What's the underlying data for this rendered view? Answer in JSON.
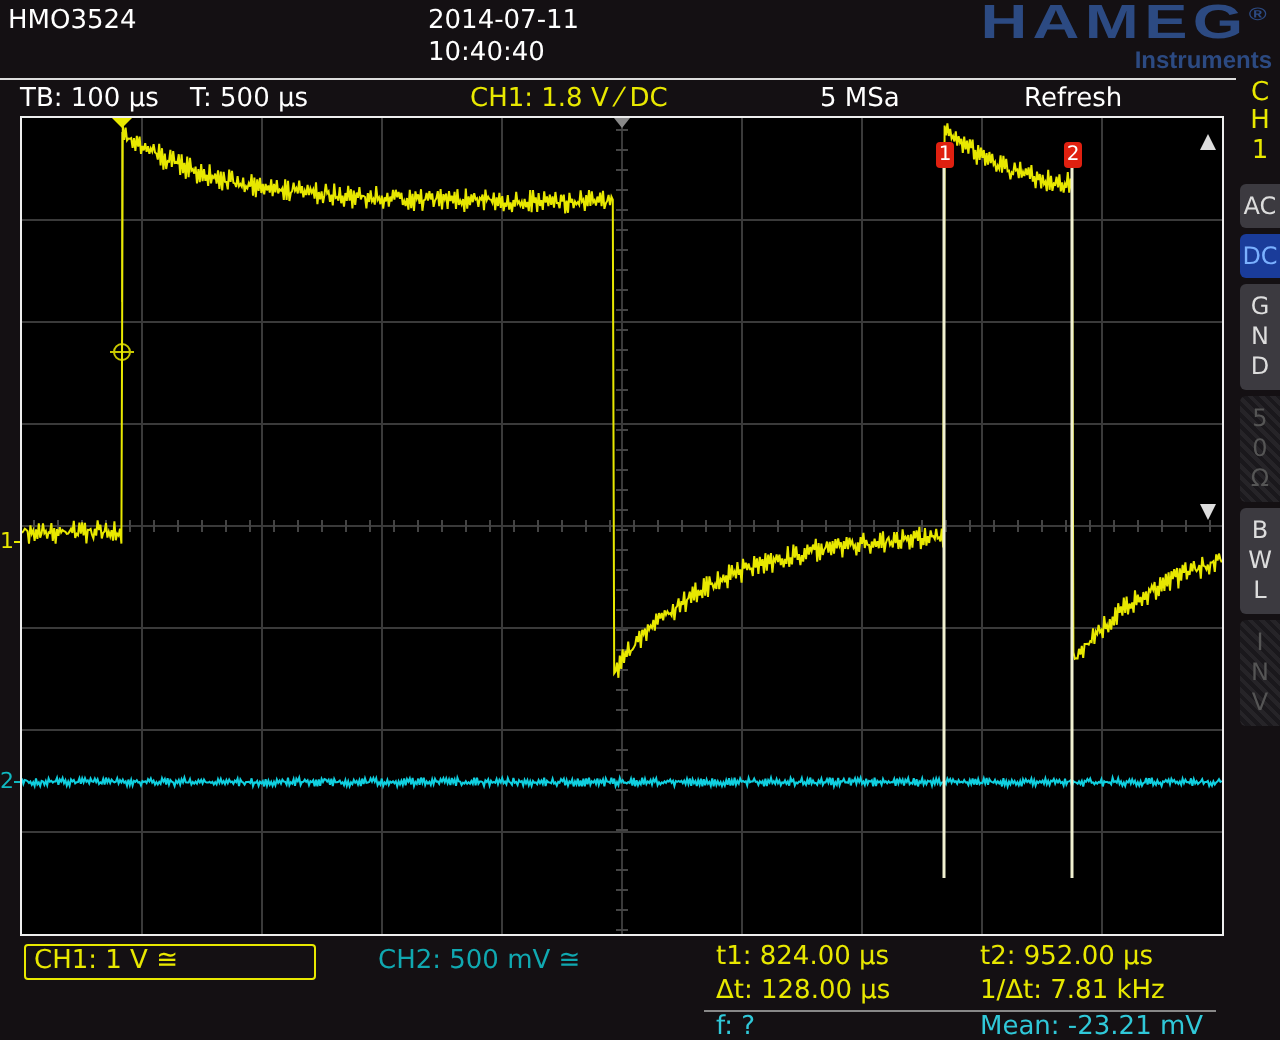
{
  "header": {
    "model": "HMO3524",
    "date": "2014-07-11",
    "time": "10:40:40",
    "brand": "HAMEG$^{®}$",
    "brand_sub": "Instruments"
  },
  "status_bar": [
    {
      "text": "TB: 100 µs",
      "kind": "info"
    },
    {
      "text": "T: 500 µs",
      "kind": "info"
    },
    {
      "text": "CH1: 1.8 V ⁄ DC",
      "kind": "channel"
    },
    {
      "text": "5 MSa",
      "kind": "info"
    },
    {
      "text": "Refresh",
      "kind": "info"
    }
  ],
  "channel_markers": [
    {
      "label": "1",
      "color": "#e8e800"
    },
    {
      "label": "2",
      "color": "#10b8c0"
    }
  ],
  "cursors": [
    {
      "label": "1"
    },
    {
      "label": "2"
    }
  ],
  "sidebar": {
    "channel": "CH1",
    "buttons": [
      {
        "label": "AC",
        "kind": "horizontal",
        "selected": false,
        "disabled": false
      },
      {
        "label": "DC",
        "kind": "horizontal",
        "selected": true,
        "disabled": false
      },
      {
        "label": "GND",
        "kind": "vertical",
        "selected": false,
        "disabled": false
      },
      {
        "label": "50Ω",
        "kind": "vertical",
        "selected": false,
        "disabled": true
      },
      {
        "label": "BWL",
        "kind": "vertical",
        "selected": false,
        "disabled": false
      },
      {
        "label": "INV",
        "kind": "vertical",
        "selected": false,
        "disabled": true
      }
    ]
  },
  "channels": [
    {
      "label": "CH1: 1 V ≅",
      "selected": true,
      "color": "#e8e800"
    },
    {
      "label": "CH2: 500 mV ≅",
      "selected": false,
      "color": "#10a8b0"
    }
  ],
  "measurements": [
    {
      "label": "t1: 824.00 µs",
      "kind": "cursor"
    },
    {
      "label": "t2: 952.00 µs",
      "kind": "cursor"
    },
    {
      "label": "Δt: 128.00 µs",
      "kind": "cursor"
    },
    {
      "label": "1/Δt: 7.81 kHz",
      "kind": "cursor"
    },
    {
      "label": "f: ?",
      "kind": "auto"
    },
    {
      "label": "Mean: -23.21 mV",
      "kind": "auto"
    }
  ]
}
